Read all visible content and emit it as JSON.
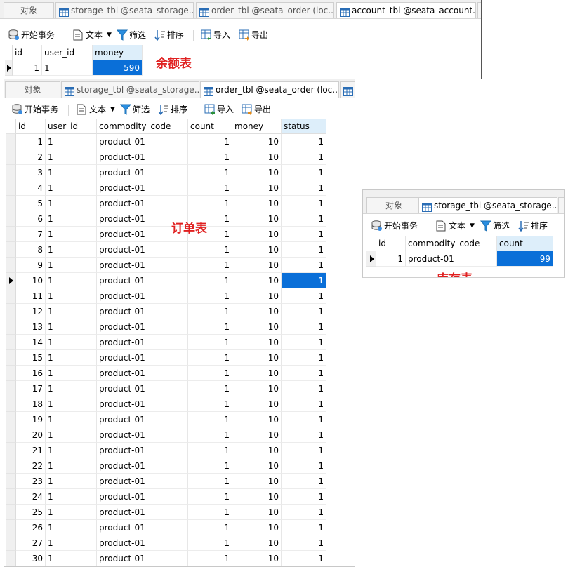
{
  "account_window": {
    "tabs": [
      "对象",
      "storage_tbl @seata_storage...",
      "order_tbl @seata_order (loc...",
      "account_tbl @seata_account..."
    ],
    "toolbar": {
      "begin": "开始事务",
      "text": "文本",
      "filter": "筛选",
      "sort": "排序",
      "import": "导入",
      "export": "导出"
    },
    "columns": [
      "id",
      "user_id",
      "money"
    ],
    "rows": [
      [
        "1",
        "1",
        "590"
      ]
    ],
    "caption": "余额表"
  },
  "order_window": {
    "tabs": [
      "对象",
      "storage_tbl @seata_storage...",
      "order_tbl @seata_order (loc..."
    ],
    "toolbar": {
      "begin": "开始事务",
      "text": "文本",
      "filter": "筛选",
      "sort": "排序",
      "import": "导入",
      "export": "导出"
    },
    "columns": [
      "id",
      "user_id",
      "commodity_code",
      "count",
      "money",
      "status"
    ],
    "rows": [
      [
        "1",
        "1",
        "product-01",
        "1",
        "10",
        "1"
      ],
      [
        "2",
        "1",
        "product-01",
        "1",
        "10",
        "1"
      ],
      [
        "3",
        "1",
        "product-01",
        "1",
        "10",
        "1"
      ],
      [
        "4",
        "1",
        "product-01",
        "1",
        "10",
        "1"
      ],
      [
        "5",
        "1",
        "product-01",
        "1",
        "10",
        "1"
      ],
      [
        "6",
        "1",
        "product-01",
        "1",
        "10",
        "1"
      ],
      [
        "7",
        "1",
        "product-01",
        "1",
        "10",
        "1"
      ],
      [
        "8",
        "1",
        "product-01",
        "1",
        "10",
        "1"
      ],
      [
        "9",
        "1",
        "product-01",
        "1",
        "10",
        "1"
      ],
      [
        "10",
        "1",
        "product-01",
        "1",
        "10",
        "1"
      ],
      [
        "11",
        "1",
        "product-01",
        "1",
        "10",
        "1"
      ],
      [
        "12",
        "1",
        "product-01",
        "1",
        "10",
        "1"
      ],
      [
        "13",
        "1",
        "product-01",
        "1",
        "10",
        "1"
      ],
      [
        "14",
        "1",
        "product-01",
        "1",
        "10",
        "1"
      ],
      [
        "15",
        "1",
        "product-01",
        "1",
        "10",
        "1"
      ],
      [
        "16",
        "1",
        "product-01",
        "1",
        "10",
        "1"
      ],
      [
        "17",
        "1",
        "product-01",
        "1",
        "10",
        "1"
      ],
      [
        "18",
        "1",
        "product-01",
        "1",
        "10",
        "1"
      ],
      [
        "19",
        "1",
        "product-01",
        "1",
        "10",
        "1"
      ],
      [
        "20",
        "1",
        "product-01",
        "1",
        "10",
        "1"
      ],
      [
        "21",
        "1",
        "product-01",
        "1",
        "10",
        "1"
      ],
      [
        "22",
        "1",
        "product-01",
        "1",
        "10",
        "1"
      ],
      [
        "23",
        "1",
        "product-01",
        "1",
        "10",
        "1"
      ],
      [
        "24",
        "1",
        "product-01",
        "1",
        "10",
        "1"
      ],
      [
        "25",
        "1",
        "product-01",
        "1",
        "10",
        "1"
      ],
      [
        "26",
        "1",
        "product-01",
        "1",
        "10",
        "1"
      ],
      [
        "27",
        "1",
        "product-01",
        "1",
        "10",
        "1"
      ],
      [
        "30",
        "1",
        "product-01",
        "1",
        "10",
        "1"
      ]
    ],
    "caption": "订单表"
  },
  "storage_window": {
    "tabs": [
      "对象",
      "storage_tbl @seata_storage..."
    ],
    "toolbar": {
      "begin": "开始事务",
      "text": "文本",
      "filter": "筛选",
      "sort": "排序"
    },
    "columns": [
      "id",
      "commodity_code",
      "count"
    ],
    "rows": [
      [
        "1",
        "product-01",
        "99"
      ]
    ],
    "caption": "库存表"
  },
  "colors": {
    "selection": "#0a6fd8",
    "caption": "#e02020"
  }
}
